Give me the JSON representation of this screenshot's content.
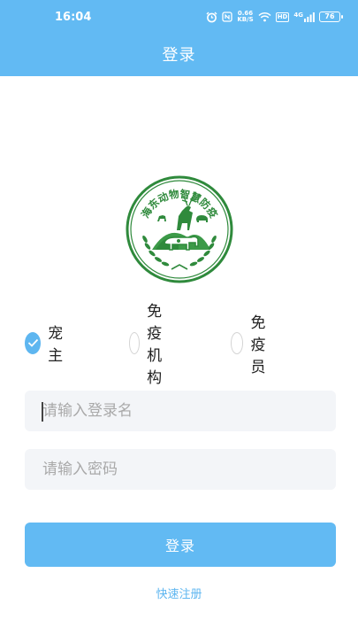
{
  "status_bar": {
    "time": "16:04",
    "net_speed_value": "0.66",
    "net_speed_unit": "KB/S",
    "hd_badge": "HD",
    "network_type": "4G",
    "battery": "76"
  },
  "header": {
    "title": "登录"
  },
  "logo": {
    "text": "海东动物智慧防疫",
    "icon": "deer-cattle-emblem"
  },
  "roles": {
    "items": [
      {
        "label": "宠主",
        "checked": true
      },
      {
        "label": "免疫机构",
        "checked": false
      },
      {
        "label": "免疫员",
        "checked": false
      }
    ]
  },
  "form": {
    "username_placeholder": "请输入登录名",
    "password_placeholder": "请输入密码",
    "login_label": "登录",
    "register_label": "快速注册"
  },
  "colors": {
    "primary": "#62baf3",
    "logo_green": "#2f8a3c",
    "input_bg": "#f3f5f8"
  }
}
